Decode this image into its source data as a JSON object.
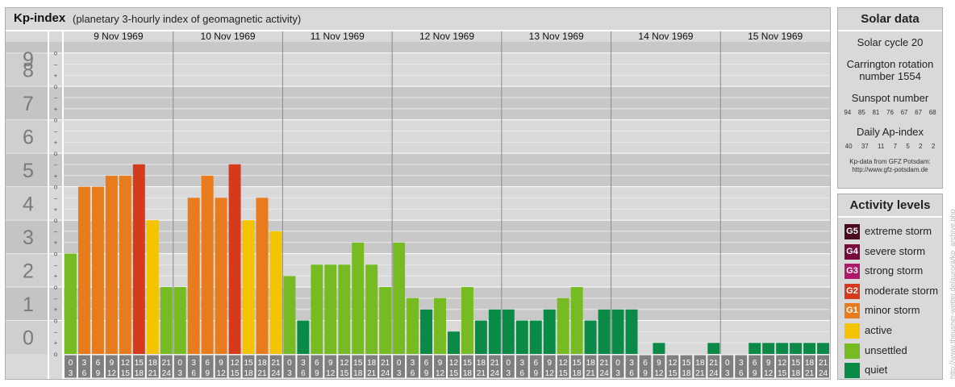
{
  "header": {
    "title": "Kp-index",
    "subtitle": "(planetary 3-hourly index of geomagnetic activity)"
  },
  "chart_data": {
    "type": "bar",
    "days": [
      "9 Nov 1969",
      "10 Nov 1969",
      "11 Nov 1969",
      "12 Nov 1969",
      "13 Nov 1969",
      "14 Nov 1969",
      "15 Nov 1969"
    ],
    "interval_start_labels": [
      "0",
      "3",
      "6",
      "9",
      "12",
      "15",
      "18",
      "21"
    ],
    "interval_end_labels": [
      "3",
      "6",
      "9",
      "12",
      "15",
      "18",
      "21",
      "24"
    ],
    "y_tick_labels": [
      "0",
      "1",
      "2",
      "3",
      "4",
      "5",
      "6",
      "7",
      "8",
      "9"
    ],
    "y_minor_tick_labels": [
      "+",
      "o",
      "–"
    ],
    "ylim": [
      0,
      9.33
    ],
    "values": [
      3.0,
      5.0,
      5.0,
      5.33,
      5.33,
      5.67,
      4.0,
      2.0,
      2.0,
      4.67,
      5.33,
      4.67,
      5.67,
      4.0,
      4.67,
      3.67,
      2.33,
      1.0,
      2.67,
      2.67,
      2.67,
      3.33,
      2.67,
      2.0,
      3.33,
      1.67,
      1.33,
      1.67,
      0.67,
      2.0,
      1.0,
      1.33,
      1.33,
      1.0,
      1.0,
      1.33,
      1.67,
      2.0,
      1.0,
      1.33,
      1.33,
      1.33,
      0.0,
      0.33,
      0.0,
      0.0,
      0.0,
      0.33,
      0.0,
      0.0,
      0.33,
      0.33,
      0.33,
      0.33,
      0.33,
      0.33
    ],
    "bar_colors": [
      "#77bb22",
      "#e87c1c",
      "#e87c1c",
      "#e87c1c",
      "#e87c1c",
      "#d63a1c",
      "#f5c400",
      "#77bb22",
      "#77bb22",
      "#e87c1c",
      "#e87c1c",
      "#e87c1c",
      "#d63a1c",
      "#f5c400",
      "#e87c1c",
      "#f5c400",
      "#77bb22",
      "#0a8a47",
      "#77bb22",
      "#77bb22",
      "#77bb22",
      "#77bb22",
      "#77bb22",
      "#77bb22",
      "#77bb22",
      "#77bb22",
      "#0a8a47",
      "#77bb22",
      "#0a8a47",
      "#77bb22",
      "#0a8a47",
      "#0a8a47",
      "#0a8a47",
      "#0a8a47",
      "#0a8a47",
      "#0a8a47",
      "#77bb22",
      "#77bb22",
      "#0a8a47",
      "#0a8a47",
      "#0a8a47",
      "#0a8a47",
      "#0a8a47",
      "#0a8a47",
      "#0a8a47",
      "#0a8a47",
      "#0a8a47",
      "#0a8a47",
      "#0a8a47",
      "#0a8a47",
      "#0a8a47",
      "#0a8a47",
      "#0a8a47",
      "#0a8a47",
      "#0a8a47",
      "#0a8a47"
    ]
  },
  "solar_data": {
    "title": "Solar data",
    "solar_cycle": "Solar cycle 20",
    "carrington_line1": "Carrington rotation",
    "carrington_line2": "number 1554",
    "sunspot_title": "Sunspot number",
    "sunspot_values": [
      "94",
      "85",
      "81",
      "76",
      "67",
      "67",
      "68"
    ],
    "ap_title": "Daily Ap-index",
    "ap_values": [
      "40",
      "37",
      "11",
      "7",
      "5",
      "2",
      "2"
    ],
    "footnote_line1": "Kp-data from GFZ Potsdam:",
    "footnote_line2": "http://www.gfz-potsdam.de"
  },
  "activity_levels": {
    "title": "Activity levels",
    "items": [
      {
        "code": "G5",
        "label": "extreme storm",
        "color": "#4a0a24"
      },
      {
        "code": "G4",
        "label": "severe storm",
        "color": "#7a0a3c"
      },
      {
        "code": "G3",
        "label": "strong storm",
        "color": "#b0186a"
      },
      {
        "code": "G2",
        "label": "moderate storm",
        "color": "#d63a1c"
      },
      {
        "code": "G1",
        "label": "minor storm",
        "color": "#e87c1c"
      },
      {
        "code": "",
        "label": "active",
        "color": "#f5c400"
      },
      {
        "code": "",
        "label": "unsettled",
        "color": "#77bb22"
      },
      {
        "code": "",
        "label": "quiet",
        "color": "#0a8a47"
      }
    ]
  },
  "side_url": "http://www.theusner-wetter.de/aurora/kp_archive.php"
}
